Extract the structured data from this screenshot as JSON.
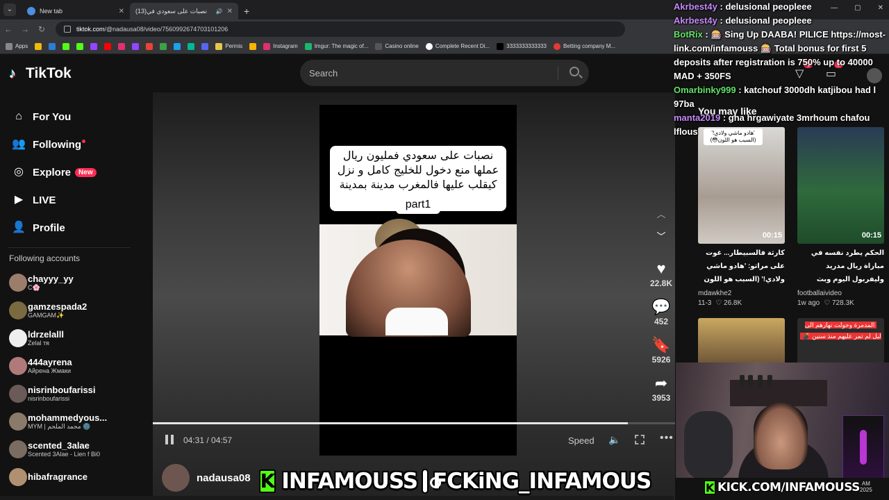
{
  "browser": {
    "tabs": [
      {
        "label": "New tab",
        "favicon": "chrome-icon"
      },
      {
        "label": "(13)نصبات على سعودي في",
        "favicon": "tiktok-icon",
        "audio": "🔊"
      }
    ],
    "url_domain": "tiktok.com",
    "url_path": "/@nadausa08/video/7560992674703101206",
    "bookmarks": [
      "Apps",
      "Permis",
      "Instagram",
      "Imgur: The magic of...",
      "Casino online",
      "Complete Recent Di...",
      "3333333333333",
      "Betting company M..."
    ]
  },
  "tiktok": {
    "logo": "TikTok",
    "search_placeholder": "Search",
    "nav": [
      {
        "label": "For You",
        "icon": "⌂"
      },
      {
        "label": "Following",
        "icon": "👥"
      },
      {
        "label": "Explore",
        "icon": "◎",
        "badge": "New"
      },
      {
        "label": "LIVE",
        "icon": "▶"
      },
      {
        "label": "Profile",
        "icon": "👤"
      }
    ],
    "following_title": "Following accounts",
    "accounts": [
      {
        "name": "chayyy_yy",
        "sub": "C🌸",
        "color": "#9a7d6b"
      },
      {
        "name": "gamzespada2",
        "sub": "GAMGAM✨",
        "color": "#7a6a40"
      },
      {
        "name": "ldrzelalll",
        "sub": "Zelal ᴛʀ",
        "color": "#eee"
      },
      {
        "name": "444ayrena",
        "sub": "Айрена Жмаки",
        "color": "#b07a7a"
      },
      {
        "name": "nisrinboufarissi",
        "sub": "nisrinboufarissi",
        "color": "#6a5a58"
      },
      {
        "name": "mohammedyous...",
        "sub": "MYM | محمد الملحم 🌚",
        "color": "#8a7a6a"
      },
      {
        "name": "scented_3alae",
        "sub": "Scented 3Alae - Lien f Bi0",
        "color": "#7a6c60"
      },
      {
        "name": "hibafragrance",
        "sub": "",
        "color": "#b09070"
      }
    ],
    "video": {
      "caption": "نصبات على سعودي فمليون ريال عملها منع دخول للخليج كامل و نزل كيقلب عليها فالمغرب مدينة بمدينة",
      "part": "part1",
      "time": "04:31 / 04:57",
      "progress": 0.91,
      "speed": "Speed",
      "author": "nadausa08"
    },
    "actions": [
      {
        "icon": "♥",
        "count": "22.8K",
        "name": "like"
      },
      {
        "icon": "💬",
        "count": "452",
        "name": "comment"
      },
      {
        "icon": "🔖",
        "count": "5926",
        "name": "save"
      },
      {
        "icon": "➦",
        "count": "3953",
        "name": "share"
      }
    ],
    "you_may_like": "You may like",
    "recs": [
      {
        "title": "كارثة فالسبيطار... غوت على مراتو: 'هادو ماشي ولادي!' (السبب هو اللون 😳)...",
        "author": "mdawkhe2",
        "date": "11-3",
        "likes": "26.8K",
        "duration": "00:15",
        "thumb_text": "'هادو ماشي ولادي!' (السبب هو اللون😳)"
      },
      {
        "title": "الحكم يطرد نفسه في مباراة ريال مدريد وليفربول اليوم وبث مباشر مباراة ليفربول وريال مدريد...",
        "author": "footballaivideo",
        "date": "1w ago",
        "likes": "728.3K",
        "duration": "00:15"
      },
      {
        "thumb_text": "المدمرة وحولت نهارهم الى ليل لم تمر عليهم منذ سنين 💣"
      }
    ],
    "top_badges": [
      "4",
      "9"
    ]
  },
  "chat": [
    {
      "user": "Akrbest4y",
      "text": "delusional peopleee",
      "color": "#c58af9"
    },
    {
      "user": "Akrbest4y",
      "text": "delusional peopleee",
      "color": "#c58af9"
    },
    {
      "user": "BotRix",
      "text": "🎰 Sing Up DAABA! PILICE https://most-link.com/infamouss 🎰 Total bonus for first 5 deposits after registration is 750% up to 40000 MAD + 350FS",
      "color": "#62e36a"
    },
    {
      "user": "Omarbinky999",
      "text": "katchouf 3000dh katjibou had l 97ba",
      "color": "#62e36a"
    },
    {
      "user": "manta2019",
      "text": "gha hrgawiyate 3mrhoum chafou lflous",
      "color": "#c58af9"
    }
  ],
  "overlay": {
    "kick_text": "INFAMOUSS",
    "ig_text": "FCKiNG_INFAMOUS",
    "kick_url": "KICK.COM/INFAMOUSS",
    "clock_time": "AM",
    "clock_date": "2025"
  }
}
